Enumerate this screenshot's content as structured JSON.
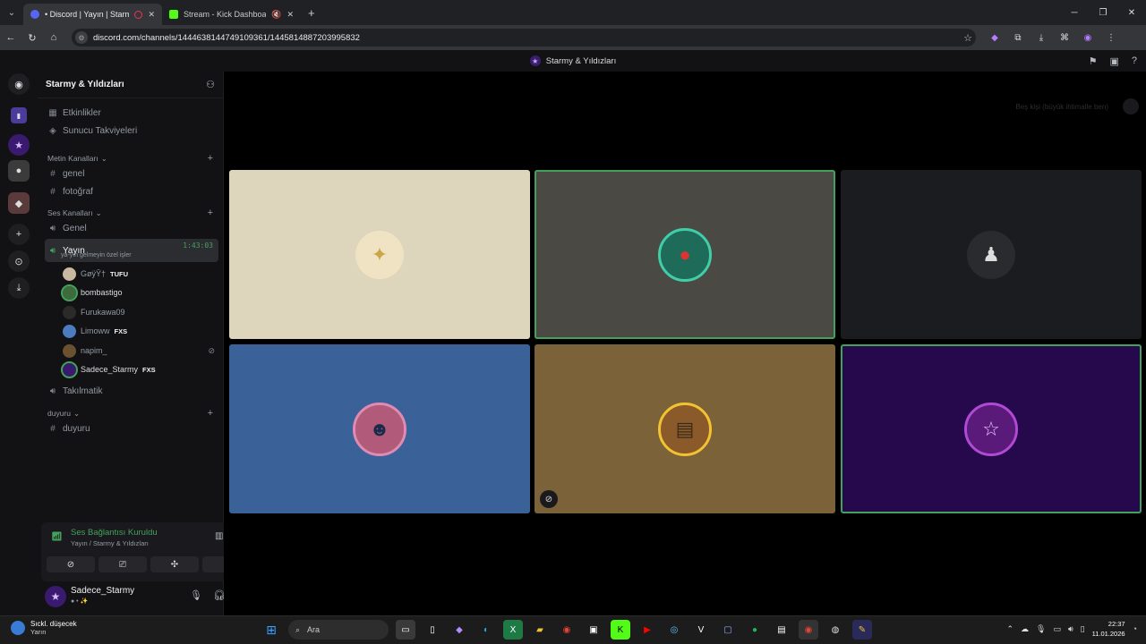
{
  "browser": {
    "tabs": [
      {
        "title": "• Discord | Yayın | Starmy &",
        "active": true
      },
      {
        "title": "Stream - Kick Dashboard",
        "active": false
      }
    ],
    "url": "discord.com/channels/1444638144749109361/1445814887203995832"
  },
  "discord": {
    "window_title": "Starmy & Yıldızları",
    "server_name": "Starmy & Yıldızları",
    "top_items": [
      {
        "label": "Etkinlikler",
        "icon": "calendar-icon"
      },
      {
        "label": "Sunucu Takviyeleri",
        "icon": "boost-icon"
      }
    ],
    "categories": {
      "text": "Metin Kanalları",
      "voice": "Ses Kanalları",
      "announce": "duyuru"
    },
    "text_channels": [
      "genel",
      "fotoğraf"
    ],
    "voice_channels": {
      "genel": "Genel",
      "active": "Yayın",
      "active_time": "1:43:03",
      "active_status": "ya-yın gelmeyin özel işler",
      "other": "Takılmatik"
    },
    "announce_channels": [
      "duyuru"
    ],
    "members": [
      {
        "name": "GøÿŶ†",
        "tag": "TUFU",
        "color": "#c9b9a0"
      },
      {
        "name": "bombastigo",
        "tag": "",
        "color": "#3e6b3e"
      },
      {
        "name": "Furukawa09",
        "tag": "",
        "color": "#2a2a2a"
      },
      {
        "name": "Limoww",
        "tag": "FXS",
        "color": "#4a7cbf"
      },
      {
        "name": "napim_",
        "tag": "",
        "color": "#6b5130"
      },
      {
        "name": "Sadece_Starmy",
        "tag": "FXS",
        "color": "#3a1a6e"
      }
    ],
    "voice_panel": {
      "status": "Ses Bağlantısı Kuruldu",
      "sub": "Yayın / Starmy & Yıldızları"
    },
    "user": {
      "name": "Sadece_Starmy",
      "sub": "● • ✨"
    },
    "invite_hint": "Beş kişi (büyük ihtimalle ben)",
    "tiles": [
      {
        "bg": "#ded5bd",
        "speaking": false,
        "avatar_bg": "#efe3c4",
        "muted": false
      },
      {
        "bg": "#4b4943",
        "speaking": true,
        "avatar_bg": "#1e6b5a",
        "muted": false
      },
      {
        "bg": "#1b1c1f",
        "speaking": false,
        "avatar_bg": "#2a2b2f",
        "muted": false
      },
      {
        "bg": "#3a6299",
        "speaking": false,
        "avatar_bg": "#b15a7a",
        "muted": false
      },
      {
        "bg": "#7b6239",
        "speaking": false,
        "avatar_bg": "#8a5a2a",
        "muted": true
      },
      {
        "bg": "#26094c",
        "speaking": true,
        "avatar_bg": "#5a1a7a",
        "muted": false
      }
    ]
  },
  "taskbar": {
    "weather_title": "Sıckl. düşecek",
    "weather_sub": "Yarın",
    "search_placeholder": "Ara",
    "time": "22:37",
    "date": "11.01.2026"
  }
}
